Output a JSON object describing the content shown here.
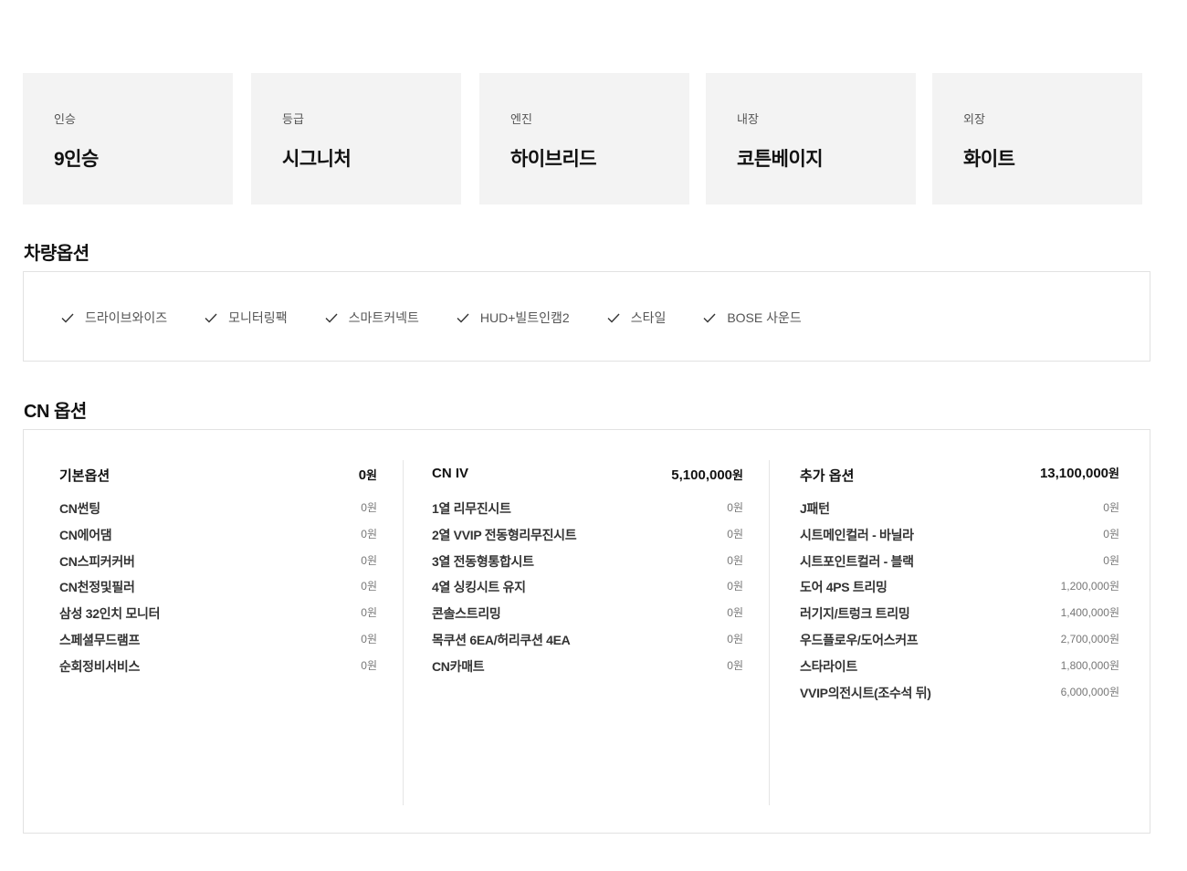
{
  "specs": [
    {
      "label": "인승",
      "value": "9인승"
    },
    {
      "label": "등급",
      "value": "시그니처"
    },
    {
      "label": "엔진",
      "value": "하이브리드"
    },
    {
      "label": "내장",
      "value": "코튼베이지"
    },
    {
      "label": "외장",
      "value": "화이트"
    }
  ],
  "vehicle_options": {
    "title": "차량옵션",
    "items": [
      "드라이브와이즈",
      "모니터링팩",
      "스마트커넥트",
      "HUD+빌트인캠2",
      "스타일",
      "BOSE 사운드"
    ]
  },
  "cn_options": {
    "title": "CN 옵션",
    "columns": [
      {
        "name": "기본옵션",
        "total": "0",
        "currency": "원",
        "items": [
          {
            "name": "CN썬팅",
            "price": "0원"
          },
          {
            "name": "CN에어댐",
            "price": "0원"
          },
          {
            "name": "CN스피커커버",
            "price": "0원"
          },
          {
            "name": "CN천정및필러",
            "price": "0원"
          },
          {
            "name": "삼성 32인치 모니터",
            "price": "0원"
          },
          {
            "name": "스페셜무드램프",
            "price": "0원"
          },
          {
            "name": "순회정비서비스",
            "price": "0원"
          }
        ]
      },
      {
        "name": "CN IV",
        "total": "5,100,000",
        "currency": "원",
        "items": [
          {
            "name": "1열 리무진시트",
            "price": "0원"
          },
          {
            "name": "2열 VVIP 전동형리무진시트",
            "price": "0원"
          },
          {
            "name": "3열 전동형통합시트",
            "price": "0원"
          },
          {
            "name": "4열 싱킹시트 유지",
            "price": "0원"
          },
          {
            "name": "콘솔스트리밍",
            "price": "0원"
          },
          {
            "name": "목쿠션 6EA/허리쿠션 4EA",
            "price": "0원"
          },
          {
            "name": "CN카매트",
            "price": "0원"
          }
        ]
      },
      {
        "name": "추가 옵션",
        "total": "13,100,000",
        "currency": "원",
        "items": [
          {
            "name": "J패턴",
            "price": "0원"
          },
          {
            "name": "시트메인컬러 - 바닐라",
            "price": "0원"
          },
          {
            "name": "시트포인트컬러 - 블랙",
            "price": "0원"
          },
          {
            "name": "도어 4PS 트리밍",
            "price": "1,200,000원"
          },
          {
            "name": "러기지/트렁크 트리밍",
            "price": "1,400,000원"
          },
          {
            "name": "우드플로우/도어스커프",
            "price": "2,700,000원"
          },
          {
            "name": "스타라이트",
            "price": "1,800,000원"
          },
          {
            "name": "VVIP의전시트(조수석 뒤)",
            "price": "6,000,000원"
          }
        ]
      }
    ]
  }
}
